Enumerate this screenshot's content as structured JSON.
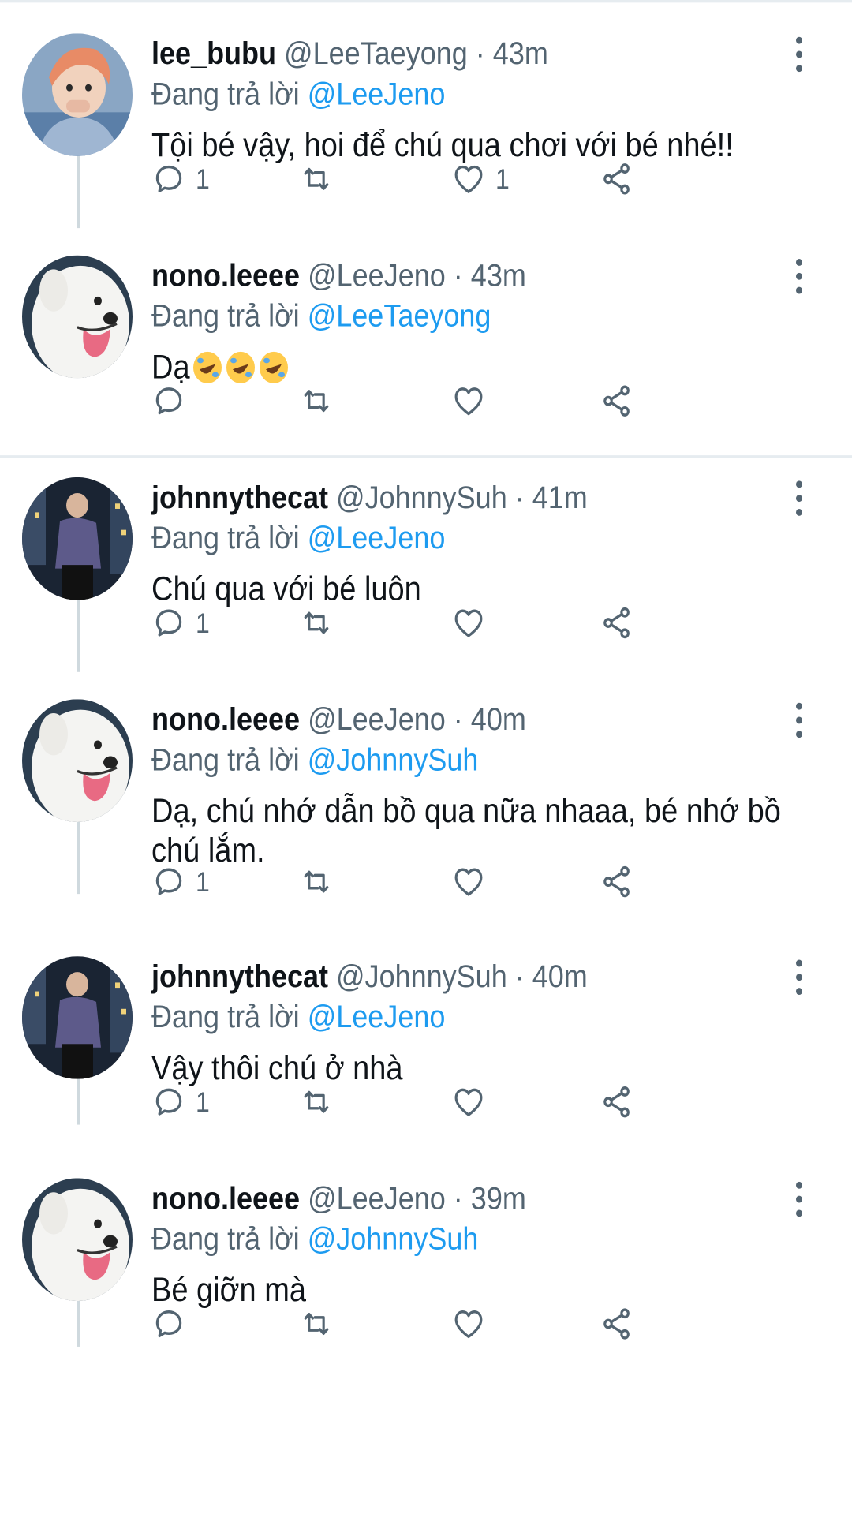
{
  "labels": {
    "replying_prefix": "Đang trả lời",
    "dot": "·"
  },
  "icons": {
    "reply": "reply-icon",
    "retweet": "retweet-icon",
    "like": "heart-icon",
    "share": "share-icon",
    "more": "more-vertical-icon"
  },
  "colors": {
    "mention": "#1d9bf0",
    "muted": "#536471",
    "text": "#0f1419",
    "divider": "#e6ecf0"
  },
  "tweets": [
    {
      "display_name": "lee_bubu",
      "handle": "@LeeTaeyong",
      "time": "43m",
      "reply_to": "@LeeJeno",
      "text": "Tội bé vậy, hoi để chú qua chơi với bé nhé!!",
      "emoji": "",
      "reply_count": "1",
      "like_count": "1"
    },
    {
      "display_name": "nono.leeee",
      "handle": "@LeeJeno",
      "time": "43m",
      "reply_to": "@LeeTaeyong",
      "text": "Dạ",
      "emoji": "rolling-on-floor-laughing ×3",
      "reply_count": "",
      "like_count": ""
    },
    {
      "display_name": "johnnythecat",
      "handle": "@JohnnySuh",
      "time": "41m",
      "reply_to": "@LeeJeno",
      "text": "Chú qua với bé luôn",
      "emoji": "",
      "reply_count": "1",
      "like_count": ""
    },
    {
      "display_name": "nono.leeee",
      "handle": "@LeeJeno",
      "time": "40m",
      "reply_to": "@JohnnySuh",
      "text": "Dạ, chú nhớ dẫn bồ qua nữa nhaaa, bé nhớ bồ chú lắm.",
      "emoji": "",
      "reply_count": "1",
      "like_count": ""
    },
    {
      "display_name": "johnnythecat",
      "handle": "@JohnnySuh",
      "time": "40m",
      "reply_to": "@LeeJeno",
      "text": "Vậy thôi chú ở nhà",
      "emoji": "",
      "reply_count": "1",
      "like_count": ""
    },
    {
      "display_name": "nono.leeee",
      "handle": "@LeeJeno",
      "time": "39m",
      "reply_to": "@JohnnySuh",
      "text": "Bé giỡn mà",
      "emoji": "",
      "reply_count": "",
      "like_count": ""
    }
  ]
}
